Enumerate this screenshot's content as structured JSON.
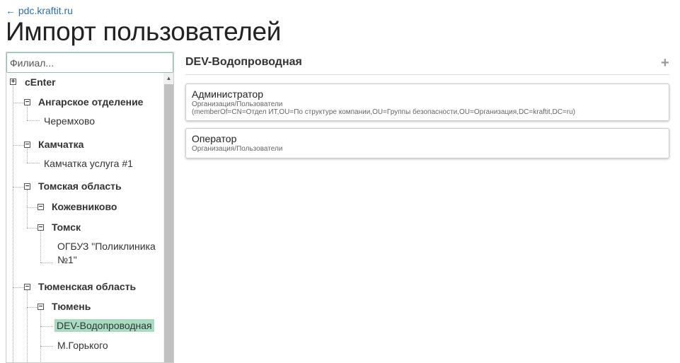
{
  "nav": {
    "back": "← pdc.kraftit.ru"
  },
  "page": {
    "title": "Импорт пользователей"
  },
  "sidebar": {
    "filter_placeholder": "Филиал...",
    "tree": {
      "root": "cEnter",
      "angarsk": "Ангарское отделение",
      "cheremkhovo": "Черемхово",
      "kamchatka": "Камчатка",
      "kamchatka_service": "Камчатка услуга #1",
      "tomsk_region": "Томская область",
      "kozhevnikovo": "Кожевниково",
      "tomsk": "Томск",
      "clinic_line1": "ОГБУЗ \"Поликлиника",
      "clinic_line2": "№1\"",
      "tyumen_region": "Тюменская область",
      "tyumen": "Тюмень",
      "dev": "DEV-Водопроводная",
      "gorky": "М.Горького"
    }
  },
  "main": {
    "title": "DEV-Водопроводная",
    "add_icon": "plus-icon",
    "cards": [
      {
        "title": "Администратор",
        "path": "Организация/Пользователи",
        "filter": "(memberOf=CN=Отдел ИТ,OU=По структуре компании,OU=Группы безопасности,OU=Организация,DC=kraftit,DC=ru)"
      },
      {
        "title": "Оператор",
        "path": "Организация/Пользователи"
      }
    ]
  },
  "colors": {
    "selected": "#a8dcc2",
    "link": "#2f6fb0"
  }
}
